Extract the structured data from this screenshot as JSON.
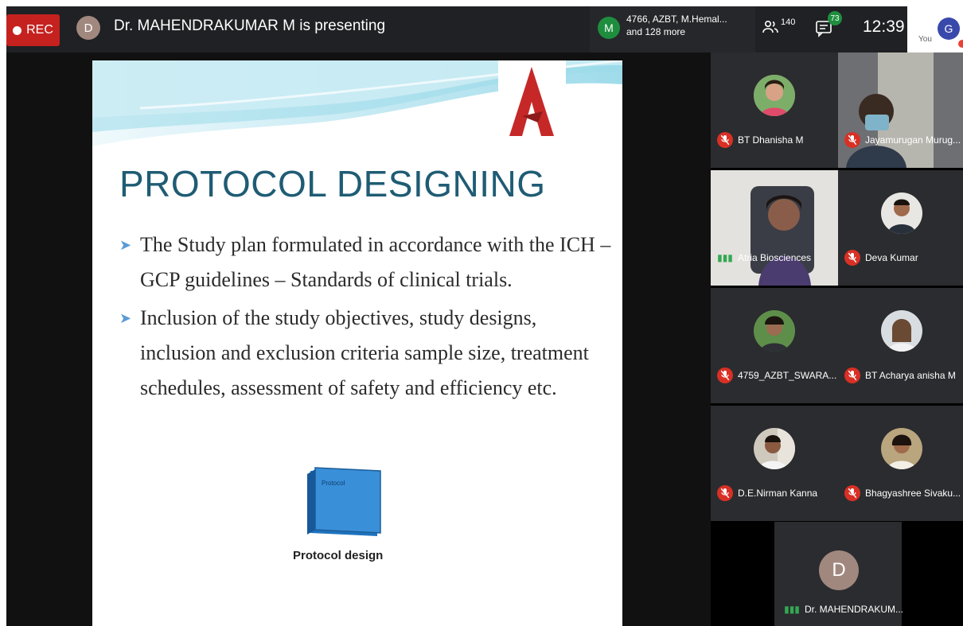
{
  "topbar": {
    "rec_label": "REC",
    "presenter_initial": "D",
    "presenting_text": "Dr. MAHENDRAKUMAR M is presenting",
    "participant_initial": "M",
    "participants_line1": "4766, AZBT, M.Hemal...",
    "participants_line2": "and 128 more",
    "people_count": "140",
    "chat_badge": "73",
    "clock": "12:39",
    "you_label": "You",
    "you_initial": "G"
  },
  "slide": {
    "title": "PROTOCOL DESIGNING",
    "bullet1": "The Study plan formulated in accordance with the ICH – GCP guidelines – Standards of clinical trials.",
    "bullet2": "Inclusion of the study objectives, study designs, inclusion and exclusion criteria sample size, treatment schedules, assessment of safety and efficiency etc.",
    "figure_label": "Protocol",
    "caption": "Protocol design"
  },
  "participants": [
    {
      "name": "BT Dhanisha M"
    },
    {
      "name": "Jayamurugan Murug..."
    },
    {
      "name": "Atria Biosciences"
    },
    {
      "name": "Deva Kumar"
    },
    {
      "name": "4759_AZBT_SWARA..."
    },
    {
      "name": "BT Acharya anisha M"
    },
    {
      "name": "D.E.Nirman Kanna"
    },
    {
      "name": "Bhagyashree Sivaku..."
    }
  ],
  "presenter_tile": {
    "initial": "D",
    "name": "Dr. MAHENDRAKUM..."
  }
}
